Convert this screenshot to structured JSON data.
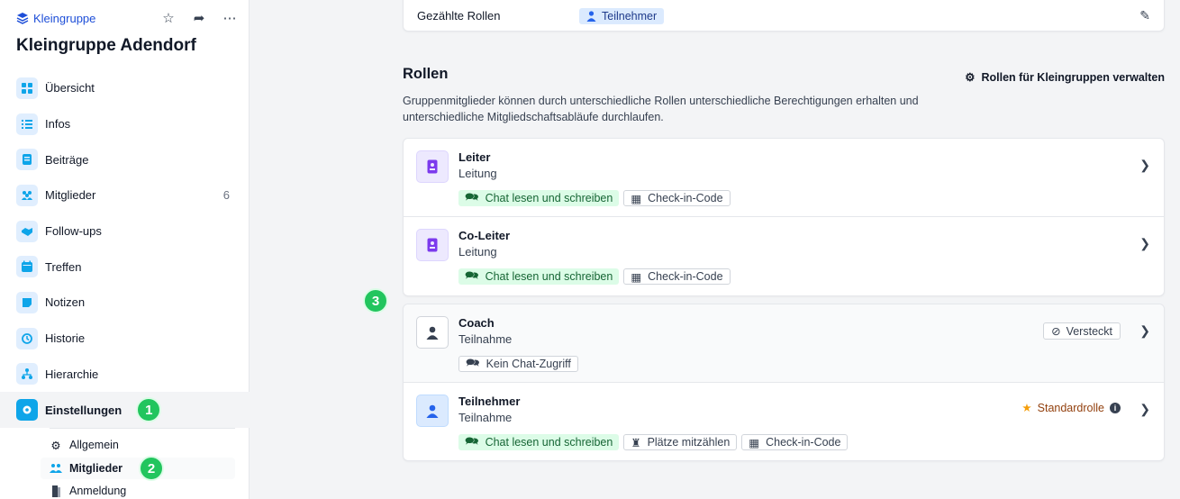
{
  "sidebar": {
    "brand": "Kleingruppe",
    "title": "Kleingruppe Adendorf",
    "items": [
      {
        "label": "Übersicht",
        "icon": "grid-icon"
      },
      {
        "label": "Infos",
        "icon": "list-icon"
      },
      {
        "label": "Beiträge",
        "icon": "posts-icon"
      },
      {
        "label": "Mitglieder",
        "icon": "users-icon",
        "count": "6"
      },
      {
        "label": "Follow-ups",
        "icon": "handshake-icon"
      },
      {
        "label": "Treffen",
        "icon": "calendar-icon"
      },
      {
        "label": "Notizen",
        "icon": "note-icon"
      },
      {
        "label": "Historie",
        "icon": "history-icon"
      },
      {
        "label": "Hierarchie",
        "icon": "hierarchy-icon"
      },
      {
        "label": "Einstellungen",
        "icon": "gear-icon"
      }
    ],
    "sub_items": [
      {
        "label": "Allgemein",
        "icon": "gear-icon"
      },
      {
        "label": "Mitglieder",
        "icon": "users-icon"
      },
      {
        "label": "Anmeldung",
        "icon": "door-icon"
      }
    ]
  },
  "annotations": {
    "a1": "1",
    "a2": "2",
    "a3": "3"
  },
  "top_card": {
    "label": "Gezählte Rollen",
    "chip": "Teilnehmer"
  },
  "roles_section": {
    "title": "Rollen",
    "manage": "Rollen für Kleingruppen verwalten",
    "description": "Gruppenmitglieder können durch unterschiedliche Rollen unterschiedliche Berechtigungen erhalten und unterschiedliche Mitgliedschaftsabläufe durchlaufen."
  },
  "roles": [
    {
      "name": "Leiter",
      "sub": "Leitung",
      "tags": [
        "Chat lesen und schreiben",
        "Check-in-Code"
      ]
    },
    {
      "name": "Co-Leiter",
      "sub": "Leitung",
      "tags": [
        "Chat lesen und schreiben",
        "Check-in-Code"
      ]
    },
    {
      "name": "Coach",
      "sub": "Teilnahme",
      "tags": [
        "Kein Chat-Zugriff"
      ],
      "right": "Versteckt"
    },
    {
      "name": "Teilnehmer",
      "sub": "Teilnahme",
      "tags": [
        "Chat lesen und schreiben",
        "Plätze mitzählen",
        "Check-in-Code"
      ],
      "right": "Standardrolle"
    }
  ],
  "colors": {
    "accent": "#0ea5e9",
    "green": "#22c55e",
    "brand": "#1d4ed8"
  }
}
